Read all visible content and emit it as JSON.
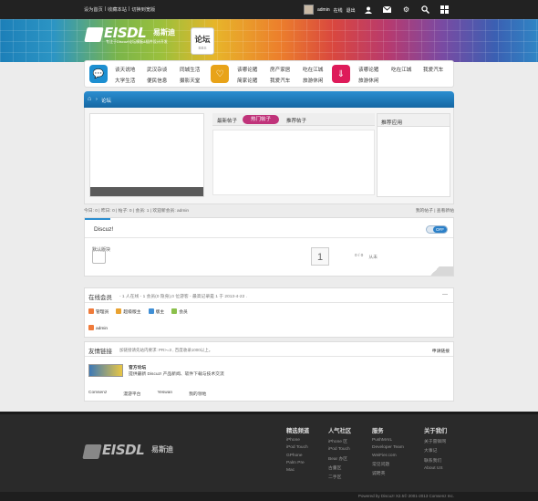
{
  "topbar": {
    "links": [
      "设为首页",
      "收藏本站",
      "切换到宽版"
    ],
    "user": "admin",
    "status": "在线",
    "logout": "退出"
  },
  "logo": {
    "name": "EISDL",
    "cn": "易斯迪",
    "tagline": "专注于Discuz!论坛模板&插件设计开发"
  },
  "section": {
    "title": "论坛",
    "sub": "BBS"
  },
  "nav": {
    "group1": [
      [
        "谈天说地",
        "武汉杂谈",
        "同城生活"
      ],
      [
        "大学生活",
        "便民信息",
        "摄影天堂"
      ]
    ],
    "group2": [
      [
        "该哪论猪",
        "房产家居",
        "吃在江城"
      ],
      [
        "简家论猪",
        "我爱汽车",
        "旅游休闲"
      ]
    ],
    "group3": [
      [
        "该哪论猪",
        "吃在江城",
        "我爱汽车"
      ],
      [
        "旅游休闲"
      ]
    ]
  },
  "breadcrumb": {
    "label": "论坛"
  },
  "tabs": {
    "t1": "最新帖子",
    "t2": "热门帖子",
    "t3": "推荐帖子"
  },
  "recommend": {
    "title": "推荐应用"
  },
  "stats": {
    "text": "今日: 0 | 昨日: 0 | 帖子: 0 | 会员: 1 | 欢迎新会员: admin",
    "right": "我的帖子 | 查看新帖"
  },
  "forum": {
    "name": "Discuz!",
    "toggle": "OFF",
    "board": "默认版块",
    "count": "1",
    "posts": "0 / 0",
    "last": "从未"
  },
  "online": {
    "title": "在线会员",
    "sub": "- 1 人在线 - 1 会员(0 隐身),0 位游客 - 最高记录是 1 于 2013-4-22 .",
    "close": "—",
    "legend": [
      "管理员",
      "超级版主",
      "版主",
      "会员"
    ],
    "member": "admin"
  },
  "friends": {
    "title": "友情链接",
    "sub": "加链接请先站内要求: PR>=3 , 百度收录1000以上。",
    "apply": "申请链接",
    "official_title": "官方论坛",
    "official_desc": "提供最新 Discuz! 产品新闻、软件下载与技术交流",
    "row": [
      "Comsenz",
      "漫游平台",
      "Yeswan",
      "我的领地"
    ]
  },
  "footer": {
    "cols": [
      {
        "title": "精选频道",
        "items": [
          "iPhone",
          "iPod Touch",
          "GPhone",
          "Palm Pre",
          "Mac"
        ]
      },
      {
        "title": "人气社区",
        "items": [
          "iPhone 区",
          "iPod Touch",
          "Bear 办区",
          "古董区",
          "二手区"
        ]
      },
      {
        "title": "服务",
        "items": [
          "PushMAIL",
          "Developer Team",
          "WeiFier.com",
          "常见问题",
          "诚聘英"
        ]
      },
      {
        "title": "关于我们",
        "items": [
          "关于雷锋网",
          "大事记",
          "联系我们",
          "About US"
        ]
      }
    ],
    "copyright": "Powered by Discuz! X2.5© 2001-2013 Comsenz Inc."
  },
  "colors": {
    "accent": "#2b8ed0",
    "hot": "#c0337a"
  }
}
